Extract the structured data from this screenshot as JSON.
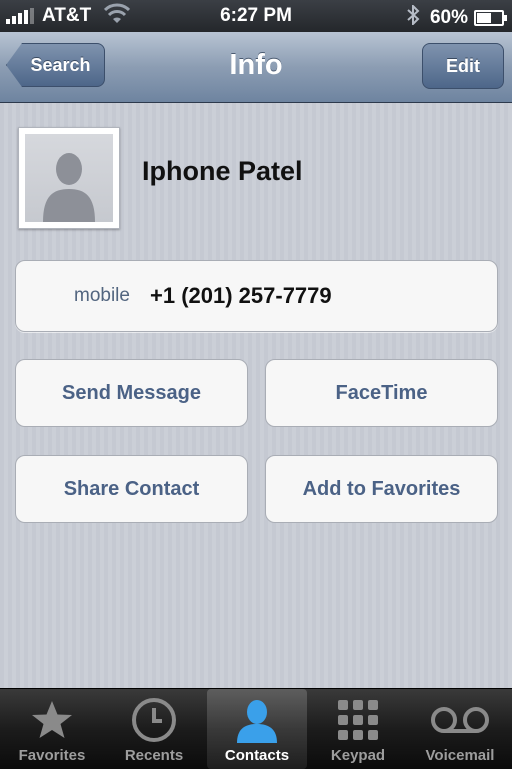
{
  "status_bar": {
    "carrier": "AT&T",
    "time": "6:27 PM",
    "battery_percent": "60%",
    "battery_level": 0.6,
    "icons": [
      "signal-icon",
      "wifi-icon",
      "bluetooth-icon",
      "battery-icon"
    ]
  },
  "navbar": {
    "back_label": "Search",
    "title": "Info",
    "edit_label": "Edit"
  },
  "contact": {
    "name": "Iphone Patel",
    "phone_label": "mobile",
    "phone_number": "+1 (201) 257-7779"
  },
  "actions": {
    "send_message": "Send Message",
    "facetime": "FaceTime",
    "share_contact": "Share Contact",
    "add_to_favorites": "Add to Favorites"
  },
  "tabbar": {
    "active": "Contacts",
    "tabs": [
      {
        "label": "Favorites",
        "icon": "star-icon"
      },
      {
        "label": "Recents",
        "icon": "clock-icon"
      },
      {
        "label": "Contacts",
        "icon": "contacts-person-icon"
      },
      {
        "label": "Keypad",
        "icon": "keypad-icon"
      },
      {
        "label": "Voicemail",
        "icon": "voicemail-icon"
      }
    ]
  },
  "colors": {
    "nav_blue": "#6e84a0",
    "action_text": "#4b6286",
    "active_tab_icon": "#3aa0ea"
  }
}
